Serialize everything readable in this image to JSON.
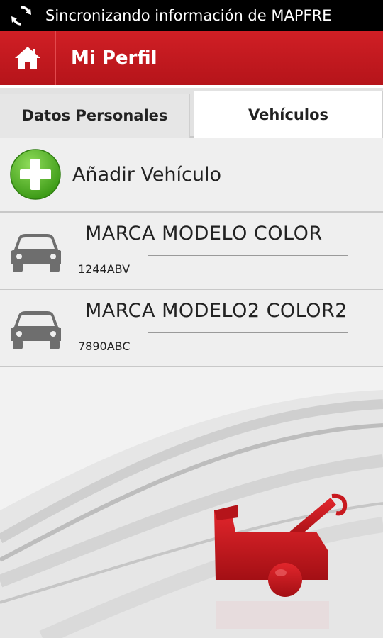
{
  "status_bar": {
    "text": "Sincronizando información de MAPFRE",
    "icon": "sync-icon"
  },
  "action_bar": {
    "title": "Mi Perfil",
    "home_icon": "home-icon",
    "color": "#c8191f"
  },
  "tabs": [
    {
      "label": "Datos Personales",
      "active": false
    },
    {
      "label": "Vehículos",
      "active": true
    }
  ],
  "add_vehicle": {
    "label": "Añadir Vehículo",
    "icon": "plus-circle-icon",
    "color": "#4caf1e"
  },
  "vehicles": [
    {
      "title": "MARCA MODELO COLOR",
      "plate": "1244ABV",
      "icon": "car-icon"
    },
    {
      "title": "MARCA MODELO2 COLOR2",
      "plate": "7890ABC",
      "icon": "car-icon"
    }
  ],
  "background": {
    "logo_icon": "tow-truck-icon",
    "accent": "#c8191f"
  }
}
